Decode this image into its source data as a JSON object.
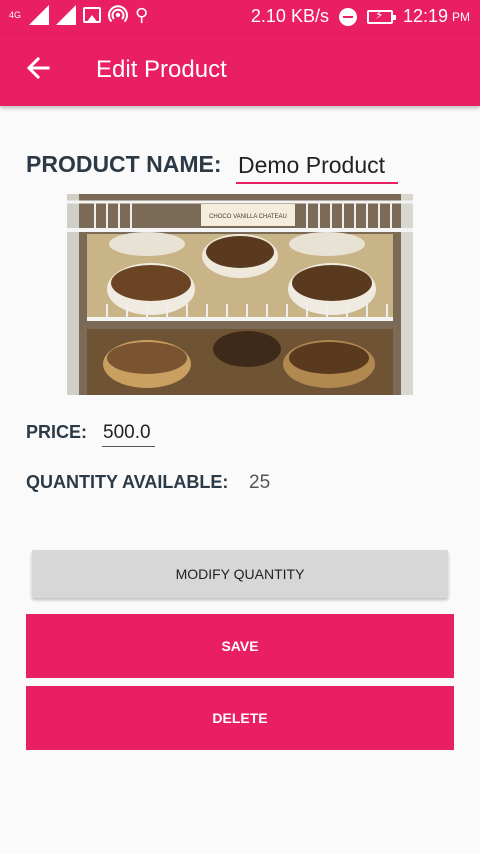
{
  "status_bar": {
    "network": "4G",
    "speed": "2.10 KB/s",
    "time": "12:19",
    "ampm": "PM",
    "icons": [
      "signal-icon",
      "signal-icon",
      "gallery-icon",
      "hotspot-icon",
      "usb-icon",
      "dnd-icon",
      "battery-charging-icon"
    ]
  },
  "app_bar": {
    "title": "Edit Product",
    "back_icon": "back-arrow-icon"
  },
  "form": {
    "name_label": "PRODUCT NAME:",
    "name_value": "Demo Product",
    "price_label": "PRICE:",
    "price_value": "500.0",
    "quantity_label": "QUANTITY AVAILABLE:",
    "quantity_value": "25"
  },
  "photo": {
    "sign_text": "CHOCO VANILLA CHATEAU"
  },
  "buttons": {
    "modify": "MODIFY QUANTITY",
    "save": "SAVE",
    "delete": "DELETE"
  },
  "colors": {
    "accent": "#e91e63",
    "label_text": "#2b3a46",
    "modify_button": "#d7d7d7"
  }
}
